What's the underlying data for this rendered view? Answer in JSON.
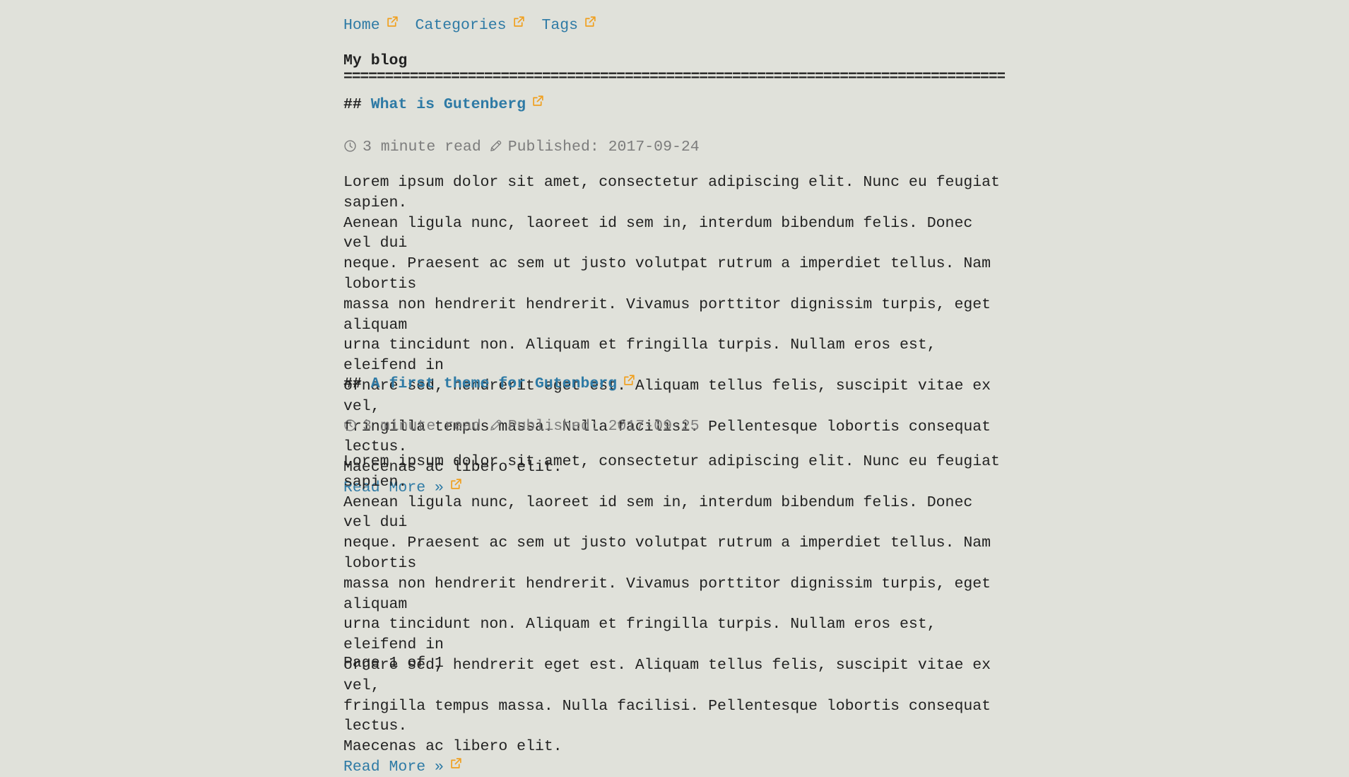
{
  "nav": {
    "items": [
      {
        "label": "Home"
      },
      {
        "label": "Categories"
      },
      {
        "label": "Tags"
      }
    ]
  },
  "blog": {
    "title": "My blog",
    "title_rule": "======================================================================================================================"
  },
  "posts": [
    {
      "heading_prefix": "##",
      "title": "What is Gutenberg",
      "read_time": "3 minute read",
      "published": "Published: 2017-09-24",
      "excerpt": "Lorem ipsum dolor sit amet, consectetur adipiscing elit. Nunc eu feugiat sapien.\nAenean ligula nunc, laoreet id sem in, interdum bibendum felis. Donec vel dui\nneque. Praesent ac sem ut justo volutpat rutrum a imperdiet tellus. Nam lobortis\nmassa non hendrerit hendrerit. Vivamus porttitor dignissim turpis, eget aliquam\nurna tincidunt non. Aliquam et fringilla turpis. Nullam eros est, eleifend in\nornare sed, hendrerit eget est. Aliquam tellus felis, suscipit vitae ex vel,\nfringilla tempus massa. Nulla facilisi. Pellentesque lobortis consequat lectus.\nMaecenas ac libero elit.",
      "read_more": "Read More »"
    },
    {
      "heading_prefix": "##",
      "title": "A first theme for Gutenberg",
      "read_time": "3 minute read",
      "published": "Published: 2017-09-25",
      "excerpt": "Lorem ipsum dolor sit amet, consectetur adipiscing elit. Nunc eu feugiat sapien.\nAenean ligula nunc, laoreet id sem in, interdum bibendum felis. Donec vel dui\nneque. Praesent ac sem ut justo volutpat rutrum a imperdiet tellus. Nam lobortis\nmassa non hendrerit hendrerit. Vivamus porttitor dignissim turpis, eget aliquam\nurna tincidunt non. Aliquam et fringilla turpis. Nullam eros est, eleifend in\nornare sed, hendrerit eget est. Aliquam tellus felis, suscipit vitae ex vel,\nfringilla tempus massa. Nulla facilisi. Pellentesque lobortis consequat lectus.\nMaecenas ac libero elit.",
      "read_more": "Read More »"
    }
  ],
  "pagination": {
    "text": "Page 1 of 1"
  },
  "icons": {
    "external_link": "external-link-icon",
    "clock": "clock-icon",
    "pencil": "pencil-icon"
  },
  "colors": {
    "background": "#e0e1da",
    "link": "#2e7aa5",
    "external_icon": "#f0a020",
    "meta_text": "#7c7c7c",
    "body_text": "#222222"
  }
}
